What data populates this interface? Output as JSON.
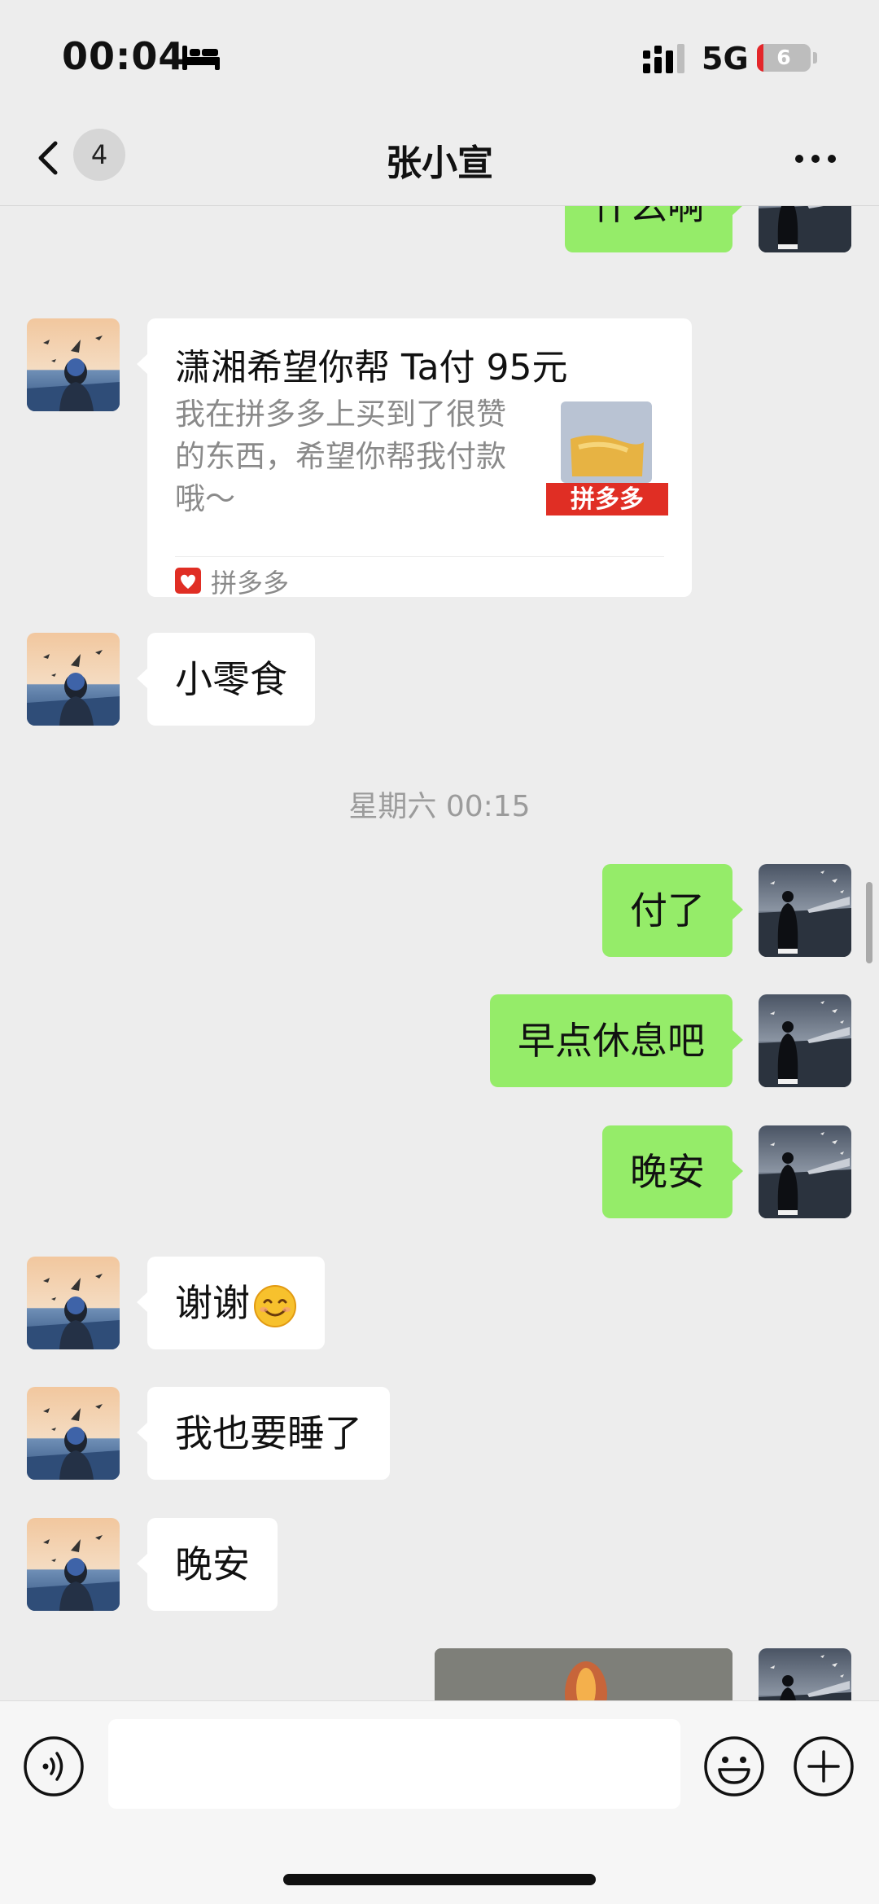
{
  "status_bar": {
    "time": "00:04",
    "focus_icon": "bed-icon",
    "signal_icon": "signal-bars-icon",
    "network": "5G",
    "battery_percent": "6",
    "battery_fill": 0.06,
    "battery_color": "#e4262a"
  },
  "nav": {
    "back_icon": "chevron-left-icon",
    "unread_count": "4",
    "title": "张小宣",
    "more_icon": "more-dots-icon"
  },
  "messages": [
    {
      "sender": "self",
      "text": "什么啊"
    },
    {
      "sender": "other",
      "type": "link-card",
      "card": {
        "title": "潇湘希望你帮 Ta付 95元",
        "description": "我在拼多多上买到了很赞的东西，希望你帮我付款哦～",
        "thumb_label": "拼多多",
        "source": "拼多多"
      }
    },
    {
      "sender": "other",
      "text": "小零食"
    },
    {
      "type": "time-divider",
      "text": "星期六 00:15"
    },
    {
      "sender": "self",
      "text": "付了"
    },
    {
      "sender": "self",
      "text": "早点休息吧"
    },
    {
      "sender": "self",
      "text": "晚安"
    },
    {
      "sender": "other",
      "text": "谢谢",
      "emoji": "smile-emoji-icon"
    },
    {
      "sender": "other",
      "text": "我也要睡了"
    },
    {
      "sender": "other",
      "text": "晚安"
    },
    {
      "sender": "self",
      "type": "image"
    }
  ],
  "input_bar": {
    "voice_icon": "voice-icon",
    "input_value": "",
    "emoji_icon": "emoji-icon",
    "plus_icon": "plus-circle-icon"
  },
  "colors": {
    "background": "#ededed",
    "self_bubble": "#95ec69",
    "other_bubble": "#ffffff",
    "time_text": "#9b9b9b",
    "pdd_red": "#e02e24"
  }
}
